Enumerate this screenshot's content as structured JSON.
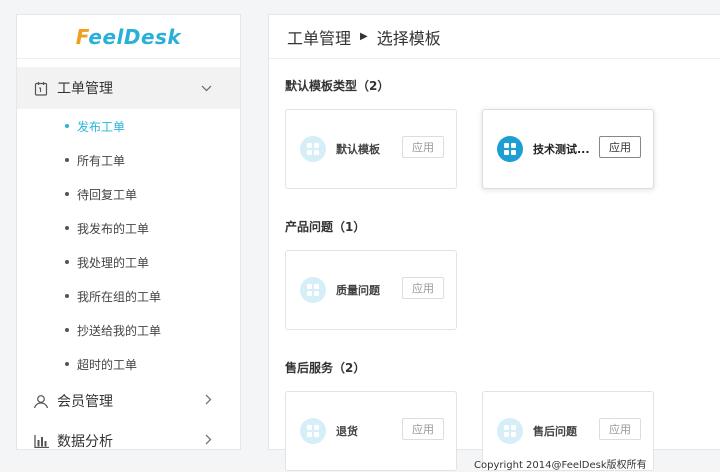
{
  "logo": {
    "text_prefix": "F",
    "text_rest": "eelDesk"
  },
  "sidebar": {
    "groups": [
      {
        "label": "工单管理",
        "icon": "ticket-icon",
        "expanded": true
      },
      {
        "label": "会员管理",
        "icon": "members-icon"
      },
      {
        "label": "数据分析",
        "icon": "chart-icon"
      }
    ],
    "ticket_items": [
      "发布工单",
      "所有工单",
      "待回复工单",
      "我发布的工单",
      "我处理的工单",
      "我所在组的工单",
      "抄送给我的工单",
      "超时的工单"
    ],
    "current_item": "发布工单"
  },
  "breadcrumb": {
    "root": "工单管理",
    "current": "选择模板"
  },
  "sections": [
    {
      "title": "默认模板类型（2）",
      "templates": [
        {
          "name": "默认模板",
          "apply": "应用"
        },
        {
          "name": "技术测试...",
          "apply": "应用"
        }
      ]
    },
    {
      "title": "产品问题（1）",
      "templates": [
        {
          "name": "质量问题",
          "apply": "应用"
        }
      ]
    },
    {
      "title": "售后服务（2）",
      "templates": [
        {
          "name": "退货",
          "apply": "应用"
        },
        {
          "name": "售后问题",
          "apply": "应用"
        }
      ]
    }
  ],
  "footer": "Copyright 2014@FeelDesk版权所有",
  "colors": {
    "accent": "#29b5db",
    "selected_icon": "#1e9fd4",
    "logo_orange": "#f0a020"
  }
}
